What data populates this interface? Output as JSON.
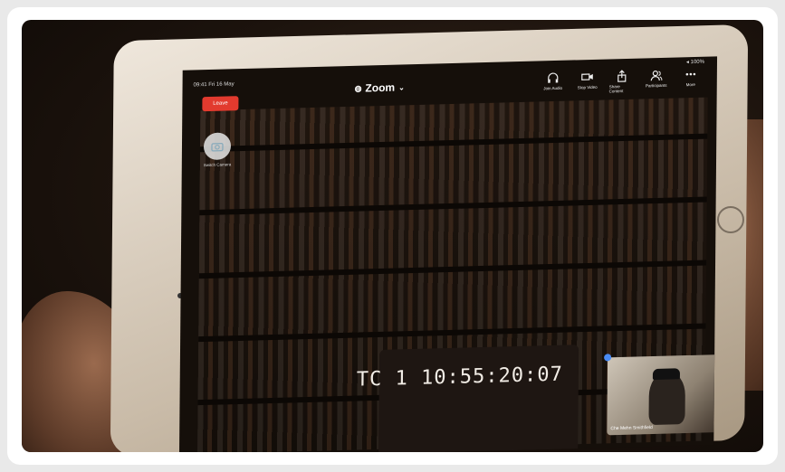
{
  "status_bar": {
    "left": "09:41  Fri 16 May",
    "right": "◂ 100%"
  },
  "meeting": {
    "title": "Zoom"
  },
  "leave_label": "Leave",
  "toolbar": [
    {
      "label": "Join Audio",
      "icon": "headphones-icon"
    },
    {
      "label": "Stop Video",
      "icon": "video-camera-icon"
    },
    {
      "label": "Share Content",
      "icon": "share-icon"
    },
    {
      "label": "Participants",
      "icon": "participants-icon"
    },
    {
      "label": "More",
      "icon": "more-icon"
    }
  ],
  "switch_camera_label": "Switch Camera",
  "video": {
    "timecode": "TC 1   10:55:20:07"
  },
  "self_view": {
    "name": "Che Mehn Smithfield"
  }
}
